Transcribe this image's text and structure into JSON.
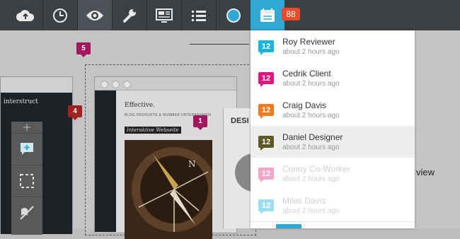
{
  "topbar": {
    "icons": [
      "cloud-upload-icon",
      "clock-icon",
      "eye-icon",
      "wrench-icon",
      "presentation-icon",
      "list-icon",
      "circle-icon",
      "calendar-icon"
    ],
    "notification_count": "88",
    "colors": {
      "bar": "#3b4045",
      "active": "#4b5157",
      "calendar": "#2fa8d6",
      "badge": "#ea4b2a"
    }
  },
  "canvas": {
    "markers": [
      "5",
      "4",
      "1"
    ],
    "left_frame_logo": "interstruct",
    "frame": {
      "heading": "Effective.",
      "nav": "BLOG   PRODUKTE & NUMMER   UNTERNEHMEN",
      "image_caption": "Interaktive Webseite"
    },
    "side_panel": {
      "title": "DESI",
      "partial_text": "view"
    },
    "tools": [
      "move-handle-icon",
      "add-comment-icon",
      "select-area-icon",
      "hide-markers-icon"
    ]
  },
  "notifications": {
    "items": [
      {
        "day": "12",
        "name": "Roy Reviewer",
        "time": "about 2 hours ago",
        "color": "#19b5dc",
        "faded": false,
        "highlight": false
      },
      {
        "day": "12",
        "name": "Cedrik Client",
        "time": "about 2 hours ago",
        "color": "#e3147e",
        "faded": false,
        "highlight": false
      },
      {
        "day": "12",
        "name": "Craig Davis",
        "time": "about 2 hours ago",
        "color": "#f07a1e",
        "faded": false,
        "highlight": false
      },
      {
        "day": "12",
        "name": "Daniel Designer",
        "time": "about 2 hours ago",
        "color": "#5b5a28",
        "faded": false,
        "highlight": true
      },
      {
        "day": "12",
        "name": "Conny Co-Worker",
        "time": "about 2 hours ago",
        "color": "#f3a6c7",
        "faded": true,
        "highlight": false
      },
      {
        "day": "12",
        "name": "Miles Davis",
        "time": "about 2 hours ago",
        "color": "#9fdcef",
        "faded": true,
        "highlight": false
      }
    ]
  }
}
